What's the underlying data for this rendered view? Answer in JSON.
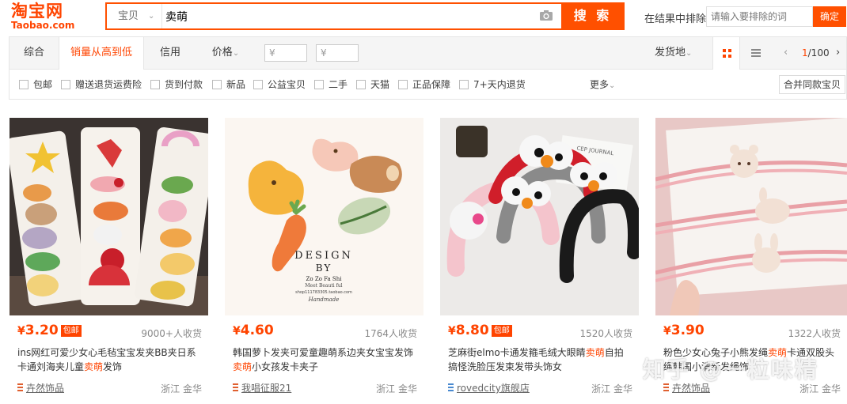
{
  "logo": {
    "cn": "淘宝网",
    "en": "Taobao.com"
  },
  "search": {
    "scope": "宝贝",
    "query": "卖萌",
    "button": "搜 索",
    "exclude_label": "在结果中排除",
    "exclude_placeholder": "请输入要排除的词",
    "confirm": "确定"
  },
  "sort": {
    "tabs": [
      "综合",
      "销量从高到低",
      "信用",
      "价格"
    ],
    "active": "销量从高到低",
    "price_from": "¥",
    "price_to": "¥",
    "dash": "-",
    "location": "发货地",
    "pager_current": "1",
    "pager_total": "/100"
  },
  "filters": {
    "options": [
      "包邮",
      "赠送退货运费险",
      "货到付款",
      "新品",
      "公益宝贝",
      "二手",
      "天猫",
      "正品保障",
      "7+天内退货"
    ],
    "more": "更多",
    "merge": "合并同款宝贝"
  },
  "products": [
    {
      "currency": "¥",
      "price": "3.20",
      "baoyou": "包邮",
      "sales": "9000+人收货",
      "title_a": "ins网红可爱少女心毛毡宝宝发夹BB夹日系卡通刘海夹儿童",
      "title_hl": "卖萌",
      "title_b": "发饰",
      "shop": "卉然饰品",
      "location": "浙江 金华"
    },
    {
      "currency": "¥",
      "price": "4.60",
      "baoyou": "",
      "sales": "1764人收货",
      "title_a": "韩国萝卜发夹可爱童趣萌系边夹女宝宝发饰",
      "title_hl": "卖萌",
      "title_b": "小女孩发卡夹子",
      "shop": "我唱征服21",
      "location": "浙江 金华",
      "img_text": {
        "l1": "DESIGN",
        "l2": "BY",
        "l3": "Zo Zo Fa Shi",
        "l4": "Meet Beauti ful",
        "l5": "shop111783305.taobao.com",
        "l6": "Handmade"
      }
    },
    {
      "currency": "¥",
      "price": "8.80",
      "baoyou": "包邮",
      "sales": "1520人收货",
      "title_a": "芝麻街elmo卡通发箍毛绒大眼睛",
      "title_hl": "卖萌",
      "title_b": "自拍搞怪洗脸压发束发带头饰女",
      "shop": "rovedcity旗舰店",
      "location": "浙江 金华",
      "img_text": {
        "book": "CEP JOURNAL"
      }
    },
    {
      "currency": "¥",
      "price": "3.90",
      "baoyou": "",
      "sales": "1322人收货",
      "title_a": "粉色少女心兔子小熊发绳",
      "title_hl": "卖萌",
      "title_b": "卡通双股头绳韩国小清新发绳饰",
      "shop": "卉然饰品",
      "location": "浙江 金华"
    }
  ],
  "watermark": "知乎 @一粒味精"
}
